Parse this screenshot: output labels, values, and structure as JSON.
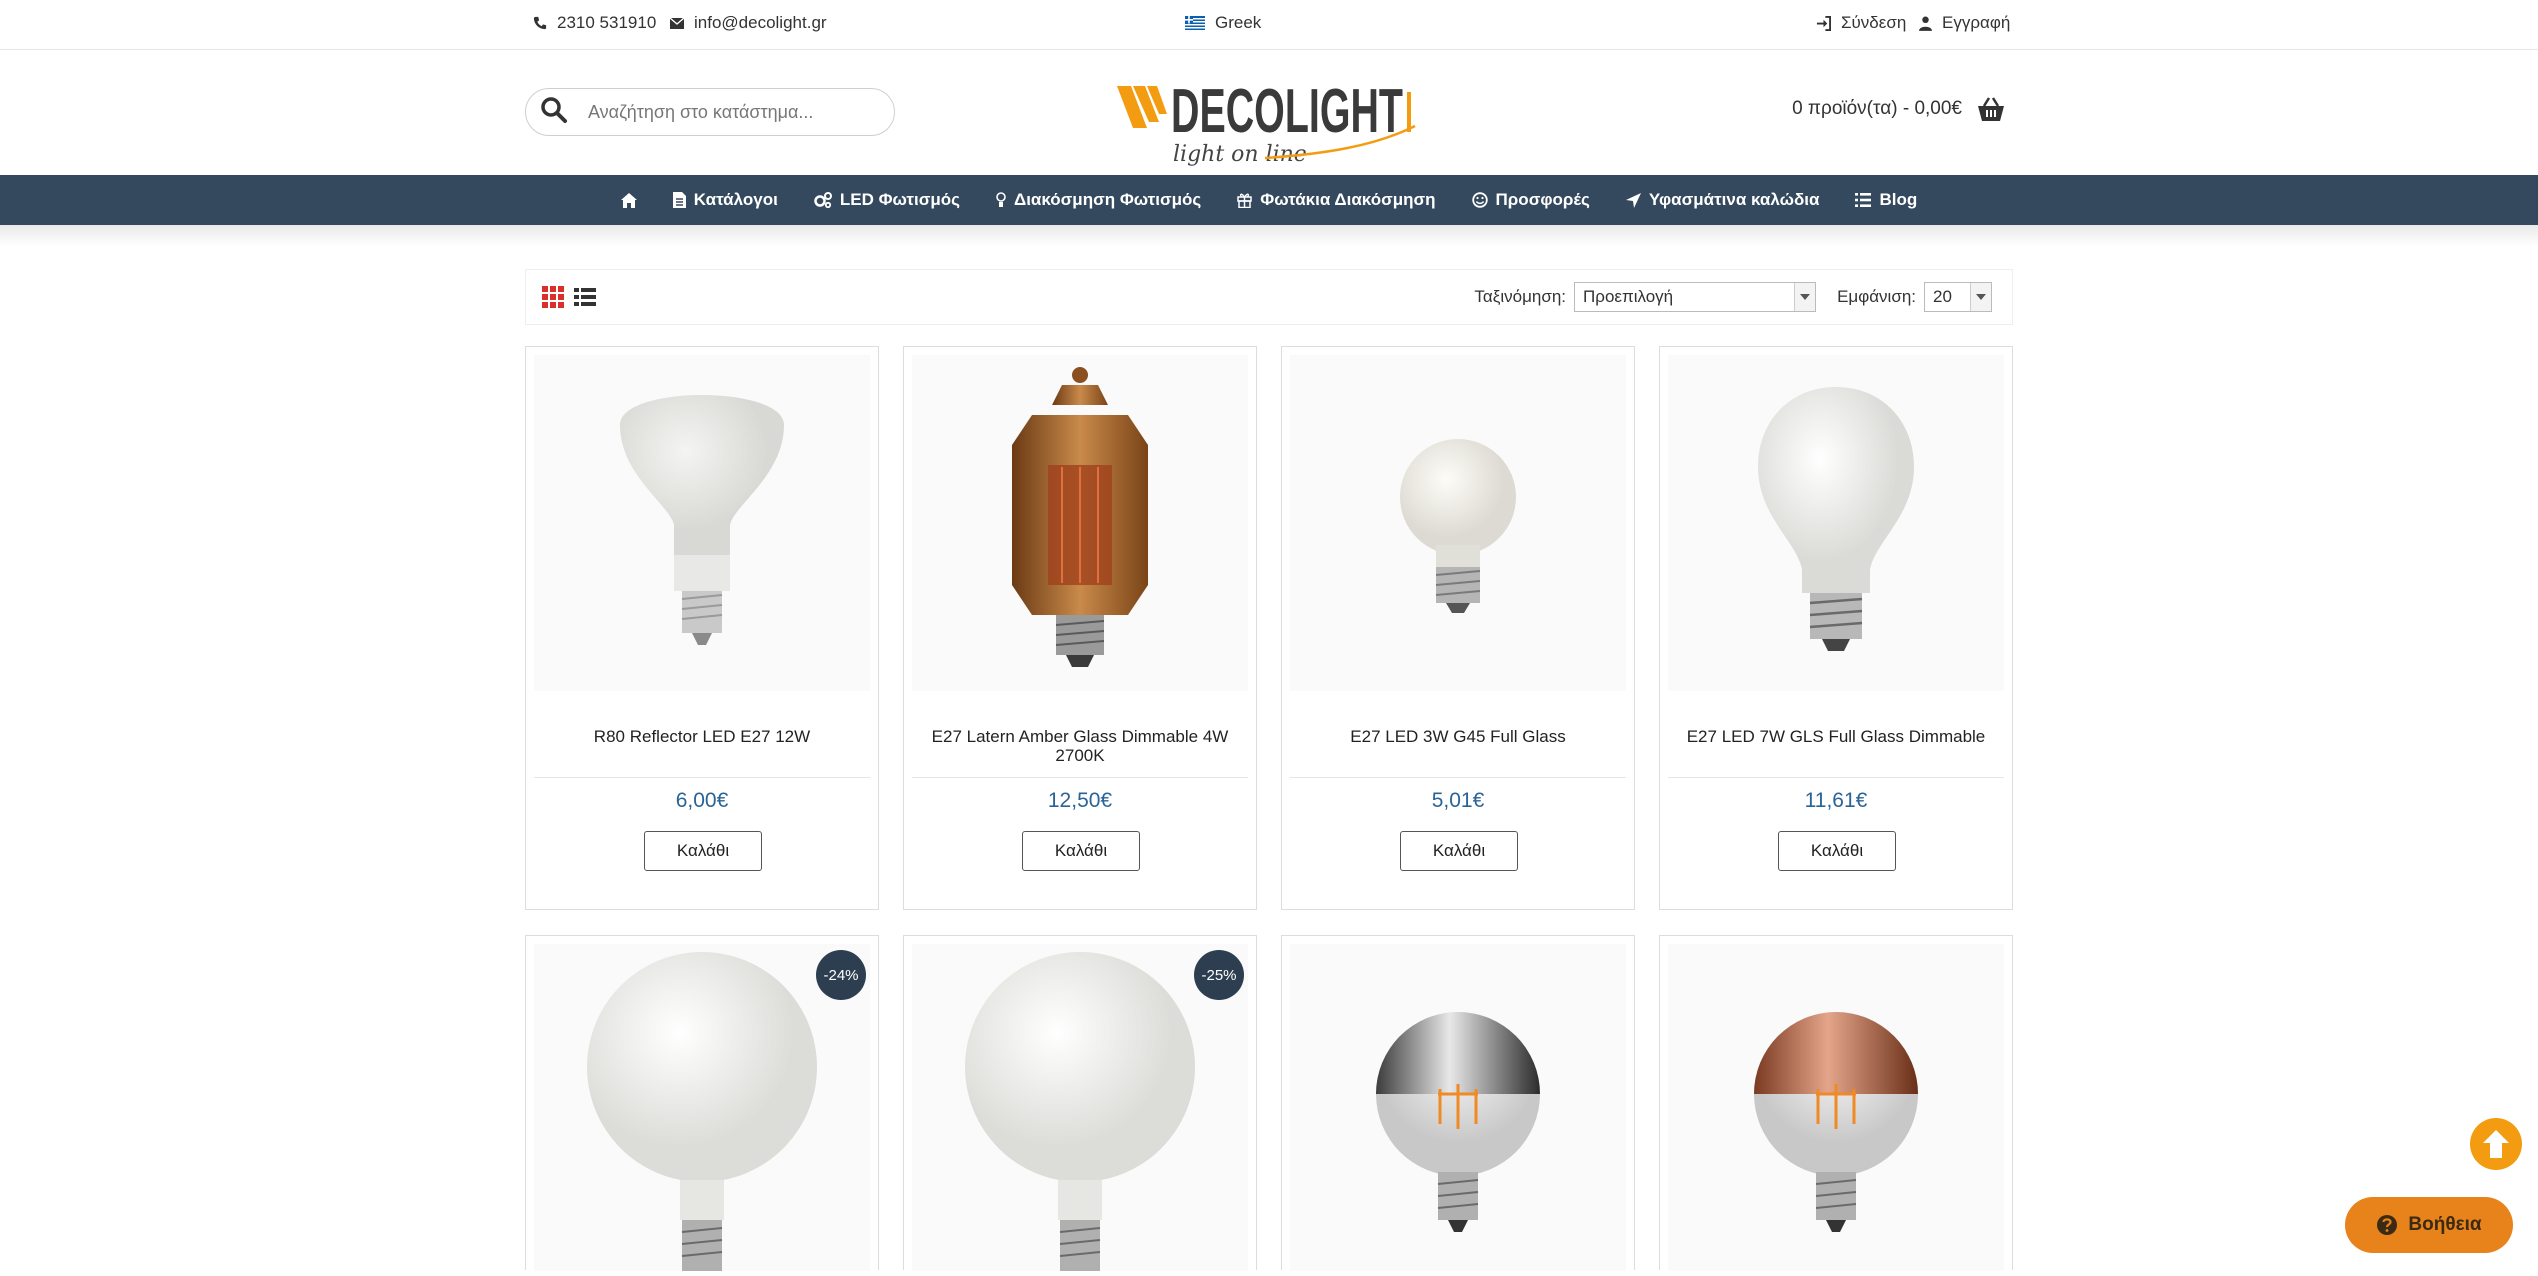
{
  "topbar": {
    "phone": "2310 531910",
    "email": "info@decolight.gr",
    "language": "Greek",
    "login": "Σύνδεση",
    "register": "Εγγραφή"
  },
  "header": {
    "search_placeholder": "Αναζήτηση στο κατάστημα...",
    "logo_text": "DECOLIGHT",
    "logo_tagline": "light on line",
    "cart_summary": "0 προϊόν(τα) - 0,00€"
  },
  "nav": {
    "items": [
      {
        "label": "Κατάλογοι",
        "icon": "document-icon"
      },
      {
        "label": "LED Φωτισμός",
        "icon": "cogs-icon"
      },
      {
        "label": "Διακόσμηση Φωτισμός",
        "icon": "lightbulb-icon"
      },
      {
        "label": "Φωτάκια Διακόσμηση",
        "icon": "gift-icon"
      },
      {
        "label": "Προσφορές",
        "icon": "smile-icon"
      },
      {
        "label": "Υφασμάτινα καλώδια",
        "icon": "location-arrow-icon"
      },
      {
        "label": "Blog",
        "icon": "list-icon"
      }
    ]
  },
  "toolbar": {
    "sort_label": "Ταξινόμηση:",
    "sort_value": "Προεπιλογή",
    "show_label": "Εμφάνιση:",
    "show_value": "20"
  },
  "products": [
    {
      "title": "R80 Reflector LED E27 12W",
      "price": "6,00€",
      "button": "Καλάθι"
    },
    {
      "title": "E27 Latern Amber Glass Dimmable 4W 2700K",
      "price": "12,50€",
      "button": "Καλάθι"
    },
    {
      "title": "E27 LED 3W G45 Full Glass",
      "price": "5,01€",
      "button": "Καλάθι"
    },
    {
      "title": "E27 LED 7W GLS Full Glass Dimmable",
      "price": "11,61€",
      "button": "Καλάθι"
    },
    {
      "badge": "-24%"
    },
    {
      "badge": "-25%"
    },
    {},
    {}
  ],
  "floating": {
    "help_label": "Βοήθεια"
  },
  "colors": {
    "nav_bg": "#34495e",
    "price": "#2a6496",
    "badge": "#2c3e50",
    "accent_orange": "#f39c12",
    "grid_view_active": "#d9302b"
  }
}
